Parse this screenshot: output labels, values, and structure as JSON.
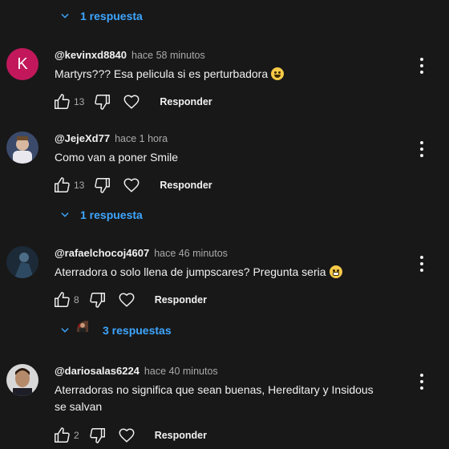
{
  "icons": {
    "chevron": "chevron-down-icon",
    "like": "thumb-up-icon",
    "dislike": "thumb-down-icon",
    "heart": "heart-icon",
    "more": "more-vert-icon"
  },
  "colors": {
    "background": "#181818",
    "link": "#3ea6ff",
    "muted": "#aaaaaa"
  },
  "top_replies_label": "1 respuesta",
  "comments": [
    {
      "author": "@kevinxd8840",
      "time": "hace 58 minutos",
      "avatar_letter": "K",
      "text": "Martyrs??? Esa pelicula si es perturbadora",
      "likes": "13",
      "reply_label": "Responder"
    },
    {
      "author": "@JejeXd77",
      "time": "hace 1 hora",
      "text": "Como van a poner Smile",
      "likes": "13",
      "reply_label": "Responder",
      "replies_label": "1 respuesta"
    },
    {
      "author": "@rafaelchocoj4607",
      "time": "hace 46 minutos",
      "text": "Aterradora o solo llena de jumpscares? Pregunta seria",
      "likes": "8",
      "reply_label": "Responder",
      "replies_label": "3 respuestas"
    },
    {
      "author": "@dariosalas6224",
      "time": "hace 40 minutos",
      "text_line1": "Aterradoras no significa que sean buenas, Hereditary y Insidous",
      "text_line2": "se salvan",
      "likes": "2",
      "reply_label": "Responder"
    }
  ]
}
